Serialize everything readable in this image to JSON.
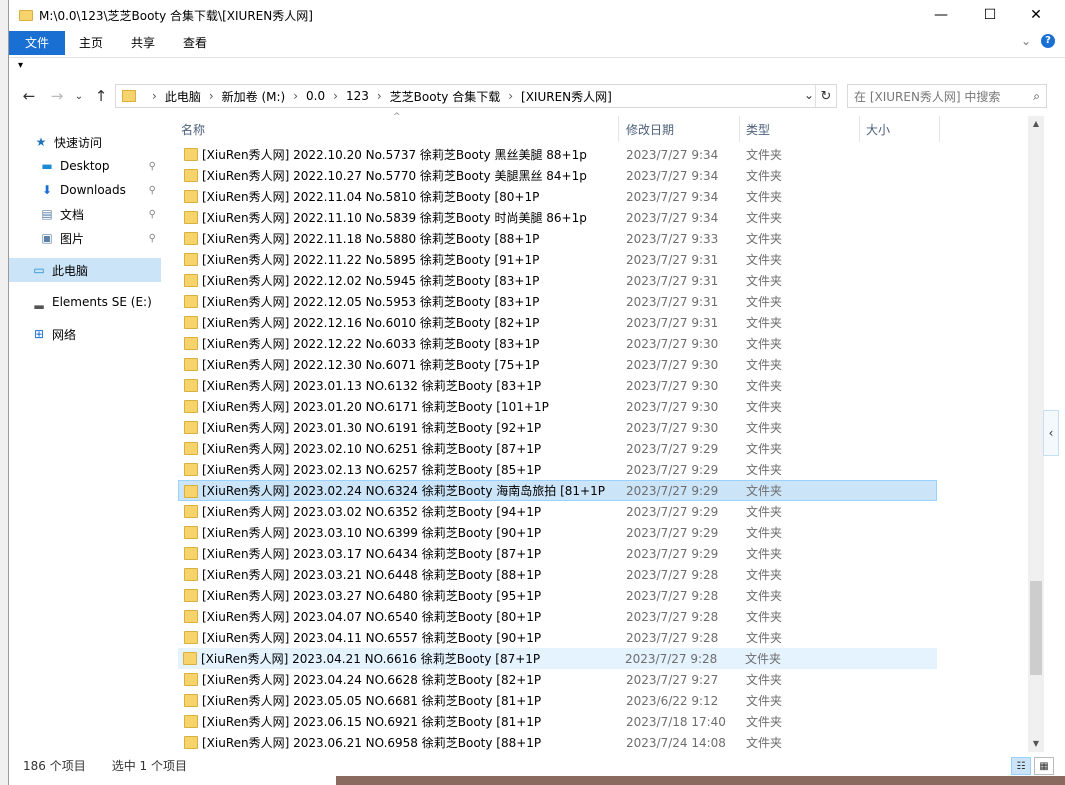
{
  "window": {
    "title": "M:\\0.0\\123\\芝芝Booty 合集下载\\[XIUREN秀人网]",
    "minimize": "—",
    "maximize": "☐",
    "close": "✕"
  },
  "ribbon": {
    "tabs": [
      "文件",
      "主页",
      "共享",
      "查看"
    ],
    "expand": "⌄",
    "help": "?"
  },
  "qat": {
    "arrow": "▾"
  },
  "nav": {
    "back": "←",
    "forward": "→",
    "recent": "⌄",
    "up": "↑",
    "breadcrumb": [
      "此电脑",
      "新加卷 (M:)",
      "0.0",
      "123",
      "芝芝Booty 合集下载",
      "[XIUREN秀人网]"
    ],
    "crumb_sep": "›",
    "dropdown": "⌄",
    "refresh": "↻",
    "search_placeholder": "在 [XIUREN秀人网] 中搜索",
    "search_icon": "⌕"
  },
  "sidebar": {
    "items": [
      {
        "label": "快速访问",
        "icon": "star-icon",
        "glyph": "★",
        "color": "#1e73be",
        "pin": false
      },
      {
        "label": "Desktop",
        "icon": "desktop-icon",
        "glyph": "▬",
        "color": "#1a8ad4",
        "pin": true
      },
      {
        "label": "Downloads",
        "icon": "downloads-icon",
        "glyph": "⬇",
        "color": "#1a6fd3",
        "pin": true
      },
      {
        "label": "文档",
        "icon": "documents-icon",
        "glyph": "▤",
        "color": "#5a7fa8",
        "pin": true
      },
      {
        "label": "图片",
        "icon": "pictures-icon",
        "glyph": "▣",
        "color": "#5a7fa8",
        "pin": true
      },
      {
        "label": "此电脑",
        "icon": "this-pc-icon",
        "glyph": "▭",
        "color": "#1a8ad4",
        "pin": false
      },
      {
        "label": "Elements SE (E:)",
        "icon": "drive-icon",
        "glyph": "▂",
        "color": "#555555",
        "pin": false
      },
      {
        "label": "网络",
        "icon": "network-icon",
        "glyph": "⊞",
        "color": "#1a6fd3",
        "pin": false
      }
    ],
    "pin_glyph": "📌"
  },
  "columns": {
    "name": "名称",
    "date": "修改日期",
    "type": "类型",
    "size": "大小",
    "sort_caret": "^"
  },
  "files": [
    {
      "name": "[XiuRen秀人网] 2022.10.20 No.5737 徐莉芝Booty 黑丝美腿 88+1p",
      "date": "2023/7/27 9:34",
      "type": "文件夹"
    },
    {
      "name": "[XiuRen秀人网] 2022.10.27 No.5770 徐莉芝Booty 美腿黑丝 84+1p",
      "date": "2023/7/27 9:34",
      "type": "文件夹"
    },
    {
      "name": "[XiuRen秀人网] 2022.11.04 No.5810 徐莉芝Booty [80+1P",
      "date": "2023/7/27 9:34",
      "type": "文件夹"
    },
    {
      "name": "[XiuRen秀人网] 2022.11.10 No.5839 徐莉芝Booty 时尚美腿 86+1p",
      "date": "2023/7/27 9:34",
      "type": "文件夹"
    },
    {
      "name": "[XiuRen秀人网] 2022.11.18 No.5880 徐莉芝Booty  [88+1P",
      "date": "2023/7/27 9:33",
      "type": "文件夹"
    },
    {
      "name": "[XiuRen秀人网] 2022.11.22 No.5895 徐莉芝Booty [91+1P",
      "date": "2023/7/27 9:31",
      "type": "文件夹"
    },
    {
      "name": "[XiuRen秀人网] 2022.12.02 No.5945 徐莉芝Booty [83+1P",
      "date": "2023/7/27 9:31",
      "type": "文件夹"
    },
    {
      "name": "[XiuRen秀人网] 2022.12.05 No.5953 徐莉芝Booty [83+1P",
      "date": "2023/7/27 9:31",
      "type": "文件夹"
    },
    {
      "name": "[XiuRen秀人网] 2022.12.16 No.6010 徐莉芝Booty [82+1P",
      "date": "2023/7/27 9:31",
      "type": "文件夹"
    },
    {
      "name": "[XiuRen秀人网] 2022.12.22 No.6033 徐莉芝Booty [83+1P",
      "date": "2023/7/27 9:30",
      "type": "文件夹"
    },
    {
      "name": "[XiuRen秀人网] 2022.12.30 No.6071 徐莉芝Booty [75+1P",
      "date": "2023/7/27 9:30",
      "type": "文件夹"
    },
    {
      "name": "[XiuRen秀人网] 2023.01.13 NO.6132 徐莉芝Booty [83+1P",
      "date": "2023/7/27 9:30",
      "type": "文件夹"
    },
    {
      "name": "[XiuRen秀人网] 2023.01.20 NO.6171 徐莉芝Booty [101+1P",
      "date": "2023/7/27 9:30",
      "type": "文件夹"
    },
    {
      "name": "[XiuRen秀人网] 2023.01.30 NO.6191 徐莉芝Booty [92+1P",
      "date": "2023/7/27 9:30",
      "type": "文件夹"
    },
    {
      "name": "[XiuRen秀人网] 2023.02.10 NO.6251 徐莉芝Booty [87+1P",
      "date": "2023/7/27 9:29",
      "type": "文件夹"
    },
    {
      "name": "[XiuRen秀人网] 2023.02.13 NO.6257 徐莉芝Booty [85+1P",
      "date": "2023/7/27 9:29",
      "type": "文件夹"
    },
    {
      "name": "[XiuRen秀人网] 2023.02.24 NO.6324 徐莉芝Booty 海南岛旅拍 [81+1P",
      "date": "2023/7/27 9:29",
      "type": "文件夹",
      "selected": true
    },
    {
      "name": "[XiuRen秀人网] 2023.03.02 NO.6352 徐莉芝Booty [94+1P",
      "date": "2023/7/27 9:29",
      "type": "文件夹"
    },
    {
      "name": "[XiuRen秀人网] 2023.03.10 NO.6399 徐莉芝Booty [90+1P",
      "date": "2023/7/27 9:29",
      "type": "文件夹"
    },
    {
      "name": "[XiuRen秀人网] 2023.03.17 NO.6434 徐莉芝Booty [87+1P",
      "date": "2023/7/27 9:29",
      "type": "文件夹"
    },
    {
      "name": "[XiuRen秀人网] 2023.03.21 NO.6448 徐莉芝Booty [88+1P",
      "date": "2023/7/27 9:28",
      "type": "文件夹"
    },
    {
      "name": "[XiuRen秀人网] 2023.03.27 NO.6480 徐莉芝Booty [95+1P",
      "date": "2023/7/27 9:28",
      "type": "文件夹"
    },
    {
      "name": "[XiuRen秀人网] 2023.04.07 NO.6540 徐莉芝Booty [80+1P",
      "date": "2023/7/27 9:28",
      "type": "文件夹"
    },
    {
      "name": "[XiuRen秀人网] 2023.04.11 NO.6557 徐莉芝Booty [90+1P",
      "date": "2023/7/27 9:28",
      "type": "文件夹"
    },
    {
      "name": "[XiuRen秀人网] 2023.04.21 NO.6616 徐莉芝Booty [87+1P",
      "date": "2023/7/27 9:28",
      "type": "文件夹",
      "hover": true
    },
    {
      "name": "[XiuRen秀人网] 2023.04.24 NO.6628 徐莉芝Booty [82+1P",
      "date": "2023/7/27 9:27",
      "type": "文件夹"
    },
    {
      "name": "[XiuRen秀人网] 2023.05.05 NO.6681 徐莉芝Booty [81+1P",
      "date": "2023/6/22 9:12",
      "type": "文件夹"
    },
    {
      "name": "[XiuRen秀人网] 2023.06.15 NO.6921 徐莉芝Booty [81+1P",
      "date": "2023/7/18 17:40",
      "type": "文件夹"
    },
    {
      "name": "[XiuRen秀人网] 2023.06.21 NO.6958 徐莉芝Booty [88+1P",
      "date": "2023/7/24 14:08",
      "type": "文件夹"
    }
  ],
  "scrollbar": {
    "up": "▲",
    "down": "▼",
    "position": 0.88
  },
  "side_panel_toggle": "‹",
  "status": {
    "count": "186 个项目",
    "selection": "选中 1 个项目",
    "details_view": "☷",
    "tiles_view": "▦"
  },
  "colors": {
    "accent": "#1a6fd3",
    "selection": "#cce4f7",
    "folder": "#f7d46b"
  }
}
